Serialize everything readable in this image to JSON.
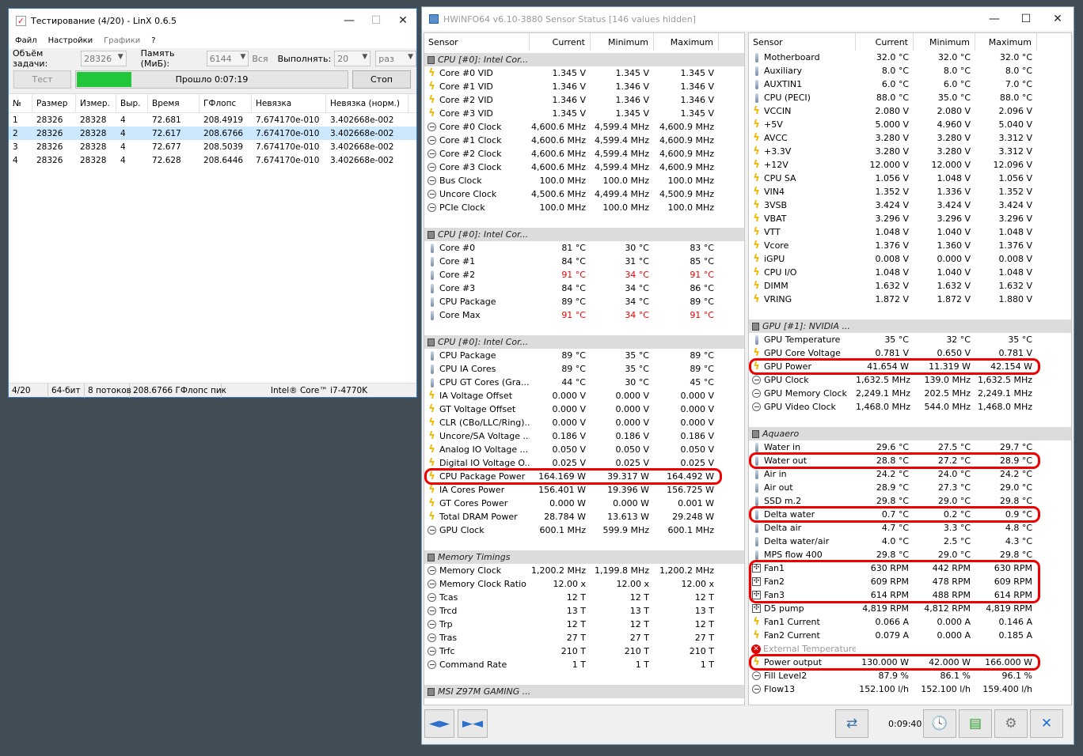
{
  "linx": {
    "title": "Тестирование (4/20) - LinX 0.6.5",
    "menu": [
      "Файл",
      "Настройки",
      "Графики",
      "?"
    ],
    "params": {
      "task_label": "Объём задачи:",
      "task_value": "28326",
      "mem_label": "Память (МиБ):",
      "mem_value": "6144",
      "all_label": "Вся",
      "run_label": "Выполнять:",
      "run_value": "20",
      "unit_value": "раз"
    },
    "test_button": "Тест",
    "stop_button": "Стоп",
    "progress_text": "Прошло 0:07:19",
    "progress_fraction": 0.2,
    "columns": [
      "№",
      "Размер",
      "Измер.",
      "Выр.",
      "Время",
      "ГФлопс",
      "Невязка",
      "Невязка (норм.)"
    ],
    "rows": [
      [
        "1",
        "28326",
        "28328",
        "4",
        "72.681",
        "208.4919",
        "7.674170e-010",
        "3.402668e-002"
      ],
      [
        "2",
        "28326",
        "28328",
        "4",
        "72.617",
        "208.6766",
        "7.674170e-010",
        "3.402668e-002"
      ],
      [
        "3",
        "28326",
        "28328",
        "4",
        "72.677",
        "208.5039",
        "7.674170e-010",
        "3.402668e-002"
      ],
      [
        "4",
        "28326",
        "28328",
        "4",
        "72.628",
        "208.6446",
        "7.674170e-010",
        "3.402668e-002"
      ]
    ],
    "selected_row": 2,
    "status": [
      "4/20",
      "64-бит",
      "8 потоков",
      "208.6766 ГФлопс пик",
      "Intel® Core™ i7-4770K"
    ]
  },
  "hwinfo": {
    "title": "HWiNFO64 v6.10-3880 Sensor Status [146 values hidden]",
    "columns": [
      "Sensor",
      "Current",
      "Minimum",
      "Maximum"
    ],
    "left_rows": [
      {
        "t": "grp",
        "n": "CPU [#0]: Intel Cor..."
      },
      {
        "t": "volt",
        "n": "Core #0 VID",
        "c": "1.345 V",
        "mi": "1.345 V",
        "ma": "1.345 V"
      },
      {
        "t": "volt",
        "n": "Core #1 VID",
        "c": "1.346 V",
        "mi": "1.346 V",
        "ma": "1.346 V"
      },
      {
        "t": "volt",
        "n": "Core #2 VID",
        "c": "1.346 V",
        "mi": "1.346 V",
        "ma": "1.346 V"
      },
      {
        "t": "volt",
        "n": "Core #3 VID",
        "c": "1.345 V",
        "mi": "1.345 V",
        "ma": "1.345 V"
      },
      {
        "t": "clock",
        "n": "Core #0 Clock",
        "c": "4,600.6 MHz",
        "mi": "4,599.4 MHz",
        "ma": "4,600.9 MHz"
      },
      {
        "t": "clock",
        "n": "Core #1 Clock",
        "c": "4,600.6 MHz",
        "mi": "4,599.4 MHz",
        "ma": "4,600.9 MHz"
      },
      {
        "t": "clock",
        "n": "Core #2 Clock",
        "c": "4,600.6 MHz",
        "mi": "4,599.4 MHz",
        "ma": "4,600.9 MHz"
      },
      {
        "t": "clock",
        "n": "Core #3 Clock",
        "c": "4,600.6 MHz",
        "mi": "4,599.4 MHz",
        "ma": "4,600.9 MHz"
      },
      {
        "t": "clock",
        "n": "Bus Clock",
        "c": "100.0 MHz",
        "mi": "100.0 MHz",
        "ma": "100.0 MHz"
      },
      {
        "t": "clock",
        "n": "Uncore Clock",
        "c": "4,500.6 MHz",
        "mi": "4,499.4 MHz",
        "ma": "4,500.9 MHz"
      },
      {
        "t": "clock",
        "n": "PCIe Clock",
        "c": "100.0 MHz",
        "mi": "100.0 MHz",
        "ma": "100.0 MHz"
      },
      {
        "t": "blank"
      },
      {
        "t": "grp",
        "n": "CPU [#0]: Intel Cor..."
      },
      {
        "t": "temp",
        "n": "Core #0",
        "c": "81 °C",
        "mi": "30 °C",
        "ma": "83 °C"
      },
      {
        "t": "temp",
        "n": "Core #1",
        "c": "84 °C",
        "mi": "31 °C",
        "ma": "85 °C"
      },
      {
        "t": "temp",
        "n": "Core #2",
        "c": "91 °C",
        "mi": "34 °C",
        "ma": "91 °C",
        "red": true
      },
      {
        "t": "temp",
        "n": "Core #3",
        "c": "84 °C",
        "mi": "34 °C",
        "ma": "86 °C"
      },
      {
        "t": "temp",
        "n": "CPU Package",
        "c": "89 °C",
        "mi": "34 °C",
        "ma": "89 °C"
      },
      {
        "t": "temp",
        "n": "Core Max",
        "c": "91 °C",
        "mi": "34 °C",
        "ma": "91 °C",
        "red": true
      },
      {
        "t": "blank"
      },
      {
        "t": "grp",
        "n": "CPU [#0]: Intel Cor..."
      },
      {
        "t": "temp",
        "n": "CPU Package",
        "c": "89 °C",
        "mi": "35 °C",
        "ma": "89 °C"
      },
      {
        "t": "temp",
        "n": "CPU IA Cores",
        "c": "89 °C",
        "mi": "35 °C",
        "ma": "89 °C"
      },
      {
        "t": "temp",
        "n": "CPU GT Cores (Gra...",
        "c": "44 °C",
        "mi": "30 °C",
        "ma": "45 °C"
      },
      {
        "t": "volt",
        "n": "IA Voltage Offset",
        "c": "0.000 V",
        "mi": "0.000 V",
        "ma": "0.000 V"
      },
      {
        "t": "volt",
        "n": "GT Voltage Offset",
        "c": "0.000 V",
        "mi": "0.000 V",
        "ma": "0.000 V"
      },
      {
        "t": "volt",
        "n": "CLR (CBo/LLC/Ring)...",
        "c": "0.000 V",
        "mi": "0.000 V",
        "ma": "0.000 V"
      },
      {
        "t": "volt",
        "n": "Uncore/SA Voltage ...",
        "c": "0.186 V",
        "mi": "0.186 V",
        "ma": "0.186 V"
      },
      {
        "t": "volt",
        "n": "Analog IO Voltage ...",
        "c": "0.050 V",
        "mi": "0.050 V",
        "ma": "0.050 V"
      },
      {
        "t": "volt",
        "n": "Digital IO Voltage O...",
        "c": "0.025 V",
        "mi": "0.025 V",
        "ma": "0.025 V"
      },
      {
        "t": "volt",
        "n": "CPU Package Power",
        "c": "164.169 W",
        "mi": "39.317 W",
        "ma": "164.492 W",
        "ring": true
      },
      {
        "t": "volt",
        "n": "IA Cores Power",
        "c": "156.401 W",
        "mi": "19.396 W",
        "ma": "156.725 W"
      },
      {
        "t": "volt",
        "n": "GT Cores Power",
        "c": "0.000 W",
        "mi": "0.000 W",
        "ma": "0.001 W"
      },
      {
        "t": "volt",
        "n": "Total DRAM Power",
        "c": "28.784 W",
        "mi": "13.613 W",
        "ma": "29.248 W"
      },
      {
        "t": "clock",
        "n": "GPU Clock",
        "c": "600.1 MHz",
        "mi": "599.9 MHz",
        "ma": "600.1 MHz"
      },
      {
        "t": "blank"
      },
      {
        "t": "grp",
        "n": "Memory Timings"
      },
      {
        "t": "clock",
        "n": "Memory Clock",
        "c": "1,200.2 MHz",
        "mi": "1,199.8 MHz",
        "ma": "1,200.2 MHz"
      },
      {
        "t": "clock",
        "n": "Memory Clock Ratio",
        "c": "12.00 x",
        "mi": "12.00 x",
        "ma": "12.00 x"
      },
      {
        "t": "clock",
        "n": "Tcas",
        "c": "12 T",
        "mi": "12 T",
        "ma": "12 T"
      },
      {
        "t": "clock",
        "n": "Trcd",
        "c": "13 T",
        "mi": "13 T",
        "ma": "13 T"
      },
      {
        "t": "clock",
        "n": "Trp",
        "c": "12 T",
        "mi": "12 T",
        "ma": "12 T"
      },
      {
        "t": "clock",
        "n": "Tras",
        "c": "27 T",
        "mi": "27 T",
        "ma": "27 T"
      },
      {
        "t": "clock",
        "n": "Trfc",
        "c": "210 T",
        "mi": "210 T",
        "ma": "210 T"
      },
      {
        "t": "clock",
        "n": "Command Rate",
        "c": "1 T",
        "mi": "1 T",
        "ma": "1 T"
      },
      {
        "t": "blank"
      },
      {
        "t": "grp",
        "n": "MSI Z97M GAMING ..."
      }
    ],
    "right_rows": [
      {
        "t": "temp",
        "n": "Motherboard",
        "c": "32.0 °C",
        "mi": "32.0 °C",
        "ma": "32.0 °C"
      },
      {
        "t": "temp",
        "n": "Auxiliary",
        "c": "8.0 °C",
        "mi": "8.0 °C",
        "ma": "8.0 °C"
      },
      {
        "t": "temp",
        "n": "AUXTIN1",
        "c": "6.0 °C",
        "mi": "6.0 °C",
        "ma": "7.0 °C"
      },
      {
        "t": "temp",
        "n": "CPU (PECI)",
        "c": "88.0 °C",
        "mi": "35.0 °C",
        "ma": "88.0 °C"
      },
      {
        "t": "volt",
        "n": "VCCIN",
        "c": "2.080 V",
        "mi": "2.080 V",
        "ma": "2.096 V"
      },
      {
        "t": "volt",
        "n": "+5V",
        "c": "5.000 V",
        "mi": "4.960 V",
        "ma": "5.040 V"
      },
      {
        "t": "volt",
        "n": "AVCC",
        "c": "3.280 V",
        "mi": "3.280 V",
        "ma": "3.312 V"
      },
      {
        "t": "volt",
        "n": "+3.3V",
        "c": "3.280 V",
        "mi": "3.280 V",
        "ma": "3.312 V"
      },
      {
        "t": "volt",
        "n": "+12V",
        "c": "12.000 V",
        "mi": "12.000 V",
        "ma": "12.096 V"
      },
      {
        "t": "volt",
        "n": "CPU SA",
        "c": "1.056 V",
        "mi": "1.048 V",
        "ma": "1.056 V"
      },
      {
        "t": "volt",
        "n": "VIN4",
        "c": "1.352 V",
        "mi": "1.336 V",
        "ma": "1.352 V"
      },
      {
        "t": "volt",
        "n": "3VSB",
        "c": "3.424 V",
        "mi": "3.424 V",
        "ma": "3.424 V"
      },
      {
        "t": "volt",
        "n": "VBAT",
        "c": "3.296 V",
        "mi": "3.296 V",
        "ma": "3.296 V"
      },
      {
        "t": "volt",
        "n": "VTT",
        "c": "1.048 V",
        "mi": "1.040 V",
        "ma": "1.048 V"
      },
      {
        "t": "volt",
        "n": "Vcore",
        "c": "1.376 V",
        "mi": "1.360 V",
        "ma": "1.376 V"
      },
      {
        "t": "volt",
        "n": "iGPU",
        "c": "0.008 V",
        "mi": "0.000 V",
        "ma": "0.008 V"
      },
      {
        "t": "volt",
        "n": "CPU I/O",
        "c": "1.048 V",
        "mi": "1.040 V",
        "ma": "1.048 V"
      },
      {
        "t": "volt",
        "n": "DIMM",
        "c": "1.632 V",
        "mi": "1.632 V",
        "ma": "1.632 V"
      },
      {
        "t": "volt",
        "n": "VRING",
        "c": "1.872 V",
        "mi": "1.872 V",
        "ma": "1.880 V"
      },
      {
        "t": "blank"
      },
      {
        "t": "grp",
        "n": "GPU [#1]: NVIDIA ..."
      },
      {
        "t": "temp",
        "n": "GPU Temperature",
        "c": "35 °C",
        "mi": "32 °C",
        "ma": "35 °C"
      },
      {
        "t": "volt",
        "n": "GPU Core Voltage",
        "c": "0.781 V",
        "mi": "0.650 V",
        "ma": "0.781 V"
      },
      {
        "t": "volt",
        "n": "GPU Power",
        "c": "41.654 W",
        "mi": "11.319 W",
        "ma": "42.154 W",
        "ring": true
      },
      {
        "t": "clock",
        "n": "GPU Clock",
        "c": "1,632.5 MHz",
        "mi": "139.0 MHz",
        "ma": "1,632.5 MHz"
      },
      {
        "t": "clock",
        "n": "GPU Memory Clock",
        "c": "2,249.1 MHz",
        "mi": "202.5 MHz",
        "ma": "2,249.1 MHz"
      },
      {
        "t": "clock",
        "n": "GPU Video Clock",
        "c": "1,468.0 MHz",
        "mi": "544.0 MHz",
        "ma": "1,468.0 MHz"
      },
      {
        "t": "blank"
      },
      {
        "t": "grp",
        "n": "Aquaero"
      },
      {
        "t": "temp",
        "n": "Water in",
        "c": "29.6 °C",
        "mi": "27.5 °C",
        "ma": "29.7 °C"
      },
      {
        "t": "temp",
        "n": "Water out",
        "c": "28.8 °C",
        "mi": "27.2 °C",
        "ma": "28.9 °C",
        "ring": true
      },
      {
        "t": "temp",
        "n": "Air in",
        "c": "24.2 °C",
        "mi": "24.0 °C",
        "ma": "24.2 °C"
      },
      {
        "t": "temp",
        "n": "Air out",
        "c": "28.9 °C",
        "mi": "27.3 °C",
        "ma": "29.0 °C"
      },
      {
        "t": "temp",
        "n": "SSD m.2",
        "c": "29.8 °C",
        "mi": "29.0 °C",
        "ma": "29.8 °C"
      },
      {
        "t": "temp",
        "n": "Delta water",
        "c": "0.7 °C",
        "mi": "0.2 °C",
        "ma": "0.9 °C",
        "ring": true
      },
      {
        "t": "temp",
        "n": "Delta air",
        "c": "4.7 °C",
        "mi": "3.3 °C",
        "ma": "4.8 °C"
      },
      {
        "t": "temp",
        "n": "Delta water/air",
        "c": "4.0 °C",
        "mi": "2.5 °C",
        "ma": "4.3 °C"
      },
      {
        "t": "temp",
        "n": "MPS flow 400",
        "c": "29.8 °C",
        "mi": "29.0 °C",
        "ma": "29.8 °C"
      },
      {
        "t": "fan",
        "n": "Fan1",
        "c": "630 RPM",
        "mi": "442 RPM",
        "ma": "630 RPM",
        "ringgrp": true
      },
      {
        "t": "fan",
        "n": "Fan2",
        "c": "609 RPM",
        "mi": "478 RPM",
        "ma": "609 RPM",
        "ringgrp": true
      },
      {
        "t": "fan",
        "n": "Fan3",
        "c": "614 RPM",
        "mi": "488 RPM",
        "ma": "614 RPM",
        "ringgrp": true
      },
      {
        "t": "fan",
        "n": "D5 pump",
        "c": "4,819 RPM",
        "mi": "4,812 RPM",
        "ma": "4,819 RPM"
      },
      {
        "t": "volt",
        "n": "Fan1 Current",
        "c": "0.066 A",
        "mi": "0.000 A",
        "ma": "0.146 A"
      },
      {
        "t": "volt",
        "n": "Fan2 Current",
        "c": "0.079 A",
        "mi": "0.000 A",
        "ma": "0.185 A"
      },
      {
        "t": "err",
        "n": "External Temperature",
        "c": "",
        "mi": "",
        "ma": ""
      },
      {
        "t": "volt",
        "n": "Power output",
        "c": "130.000 W",
        "mi": "42.000 W",
        "ma": "166.000 W",
        "ring": true
      },
      {
        "t": "clock",
        "n": "Fill Level2",
        "c": "87.9 %",
        "mi": "86.1 %",
        "ma": "96.1 %"
      },
      {
        "t": "clock",
        "n": "Flow13",
        "c": "152.100 l/h",
        "mi": "152.100 l/h",
        "ma": "159.400 l/h"
      }
    ],
    "timer": "0:09:40"
  }
}
